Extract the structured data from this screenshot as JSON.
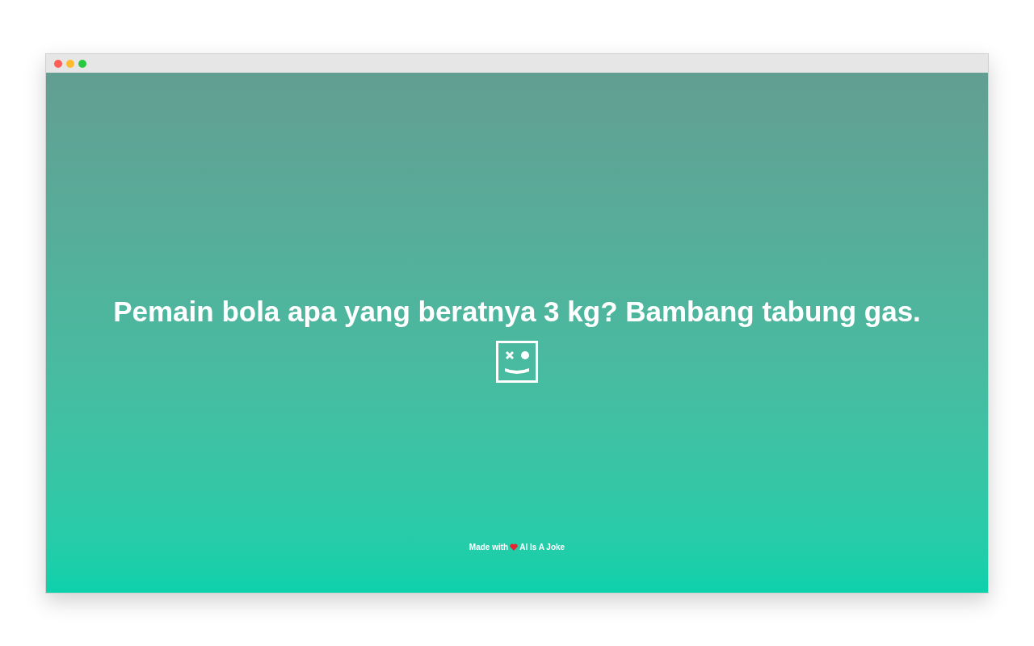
{
  "joke": "Pemain bola apa yang beratnya 3 kg? Bambang tabung gas.",
  "footer": {
    "prefix": "Made with",
    "link": "AI Is A Joke"
  }
}
